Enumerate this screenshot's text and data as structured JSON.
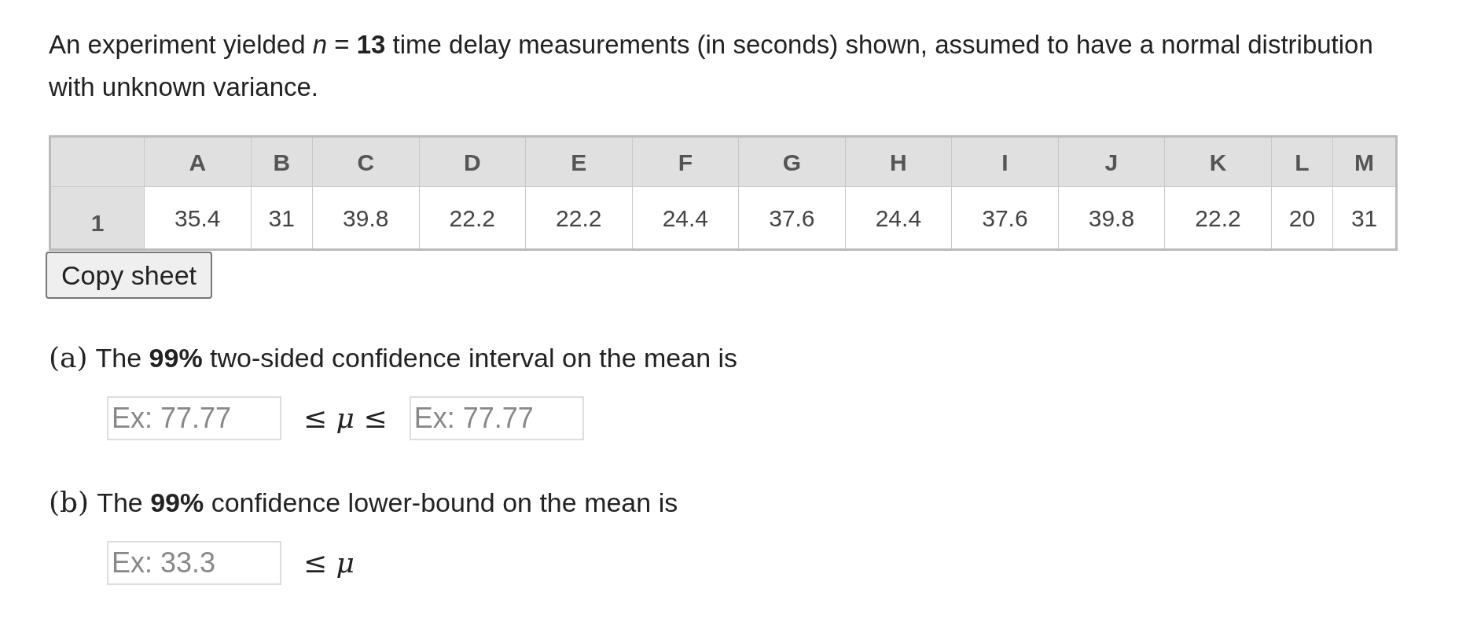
{
  "intro": "An experiment yielded *n* = **13** time delay measurements (in seconds) shown, assumed to have a normal distribution with unknown variance.",
  "sheet": {
    "columns": [
      "A",
      "B",
      "C",
      "D",
      "E",
      "F",
      "G",
      "H",
      "I",
      "J",
      "K",
      "L",
      "M"
    ],
    "rows": [
      {
        "header": "1",
        "cells": [
          "35.4",
          "31",
          "39.8",
          "22.2",
          "22.2",
          "24.4",
          "37.6",
          "24.4",
          "37.6",
          "39.8",
          "22.2",
          "20",
          "31"
        ]
      }
    ]
  },
  "copy_button": "Copy sheet",
  "questions": [
    {
      "label": "(a)",
      "text": "The **99%** two-sided confidence interval on the mean is",
      "parts": [
        {
          "kind": "field",
          "placeholder": "Ex: 77.77"
        },
        {
          "kind": "math",
          "text": "≤ *μ* ≤"
        },
        {
          "kind": "field",
          "placeholder": "Ex: 77.77"
        }
      ]
    },
    {
      "label": "(b)",
      "text": "The **99%** confidence lower-bound on the mean is",
      "parts": [
        {
          "kind": "field",
          "placeholder": "Ex: 33.3"
        },
        {
          "kind": "math",
          "text": "≤ *μ*"
        }
      ]
    }
  ]
}
